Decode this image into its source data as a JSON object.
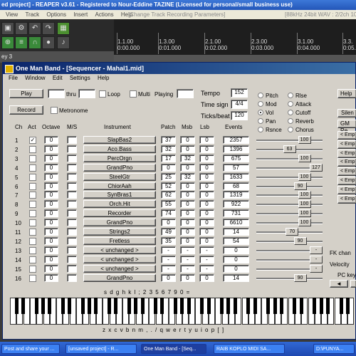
{
  "reaper": {
    "title": "ed project] - REAPER v3.61 - Registered to Nour-Eddine TAZINE (Licensed for personal/small business use)",
    "menu": [
      "View",
      "Track",
      "Options",
      "Insert",
      "Actions",
      "Help"
    ],
    "menu_info": "[Change Track Recording Parameters]",
    "menu_format": "[88kHz 24bit WAV : 2/2ch 1024sp]",
    "track_label": "ey 3",
    "timeline": [
      {
        "pos": "1.1.00",
        "time": "0:00.000"
      },
      {
        "pos": "1.3.00",
        "time": "0:01.000"
      },
      {
        "pos": "2.1.00",
        "time": "0:02.000"
      },
      {
        "pos": "2.3.00",
        "time": "0:03.000"
      },
      {
        "pos": "3.1.00",
        "time": "0:04.000"
      },
      {
        "pos": "3.3.",
        "time": "0:05."
      }
    ]
  },
  "omb": {
    "title": "One Man Band - [Sequencer - Mahal1.mid]",
    "menu": [
      "File",
      "Window",
      "Edit",
      "Settings",
      "Help"
    ],
    "play_label": "Play",
    "thru_label": "thru",
    "loop_label": "Loop",
    "multi_label": "Multi",
    "playing_label": "Playing",
    "record_label": "Record",
    "metronome_label": "Metronome",
    "tempo_label": "Tempo",
    "tempo_value": "152",
    "timesign_label": "Time sign",
    "timesign_value": "4/4",
    "ticks_label": "Ticks/beat",
    "ticks_value": "120",
    "radios": {
      "col1": [
        "Pitch",
        "Mod",
        "Vol",
        "Pan",
        "Rsnce"
      ],
      "col2": [
        "Rlse",
        "Attack",
        "Cutoff",
        "Reverb",
        "Chorus"
      ],
      "selected": "Vol"
    },
    "help_label": "Help",
    "silence_label": "Silen",
    "gmreset_label": "GM Re",
    "headers": {
      "ch": "Ch",
      "act": "Act",
      "octave": "Octave",
      "ms": "M/S",
      "instrument": "Instrument",
      "patch": "Patch",
      "msb": "Msb",
      "lsb": "Lsb",
      "events": "Events"
    },
    "rows": [
      {
        "ch": "1",
        "act": "✓",
        "oct": "0",
        "inst": "SlapBas2",
        "patch": "37",
        "msb": "0",
        "lsb": "0",
        "events": "2357",
        "vol": "100",
        "vpos": 0.78
      },
      {
        "ch": "2",
        "act": "",
        "oct": "0",
        "inst": "Aco.Bass",
        "patch": "32",
        "msb": "0",
        "lsb": "0",
        "events": "1396",
        "vol": "63",
        "vpos": 0.5
      },
      {
        "ch": "3",
        "act": "",
        "oct": "0",
        "inst": "PercOrgn",
        "patch": "17",
        "msb": "32",
        "lsb": "0",
        "events": "675",
        "vol": "100",
        "vpos": 0.78
      },
      {
        "ch": "4",
        "act": "",
        "oct": "0",
        "inst": "GrandPno",
        "patch": "0",
        "msb": "0",
        "lsb": "0",
        "events": "57",
        "vol": "127",
        "vpos": 1.0
      },
      {
        "ch": "5",
        "act": "",
        "oct": "0",
        "inst": "SteelGtr",
        "patch": "25",
        "msb": "32",
        "lsb": "0",
        "events": "1633",
        "vol": "100",
        "vpos": 0.78
      },
      {
        "ch": "6",
        "act": "",
        "oct": "0",
        "inst": "ChiorAah",
        "patch": "52",
        "msb": "0",
        "lsb": "0",
        "events": "68",
        "vol": "90",
        "vpos": 0.7
      },
      {
        "ch": "7",
        "act": "",
        "oct": "0",
        "inst": "SynBras1",
        "patch": "62",
        "msb": "0",
        "lsb": "0",
        "events": "1319",
        "vol": "100",
        "vpos": 0.78
      },
      {
        "ch": "8",
        "act": "",
        "oct": "0",
        "inst": "Orch.Hit",
        "patch": "55",
        "msb": "0",
        "lsb": "0",
        "events": "922",
        "vol": "100",
        "vpos": 0.78
      },
      {
        "ch": "9",
        "act": "",
        "oct": "0",
        "inst": "Recorder",
        "patch": "74",
        "msb": "0",
        "lsb": "0",
        "events": "731",
        "vol": "100",
        "vpos": 0.78
      },
      {
        "ch": "10",
        "act": "",
        "oct": "0",
        "inst": "GrandPno",
        "patch": "0",
        "msb": "0",
        "lsb": "0",
        "events": "6610",
        "vol": "100",
        "vpos": 0.78
      },
      {
        "ch": "11",
        "act": "",
        "oct": "0",
        "inst": "Strings2",
        "patch": "49",
        "msb": "0",
        "lsb": "0",
        "events": "14",
        "vol": "70",
        "vpos": 0.55
      },
      {
        "ch": "12",
        "act": "",
        "oct": "0",
        "inst": "Fretless",
        "patch": "35",
        "msb": "0",
        "lsb": "0",
        "events": "54",
        "vol": "90",
        "vpos": 0.7
      },
      {
        "ch": "13",
        "act": "",
        "oct": "0",
        "inst": "< unchanged >",
        "patch": "-",
        "msb": "-",
        "lsb": "-",
        "events": "0",
        "vol": "-",
        "vpos": 1.0
      },
      {
        "ch": "14",
        "act": "",
        "oct": "0",
        "inst": "< unchanged >",
        "patch": "-",
        "msb": "-",
        "lsb": "-",
        "events": "0",
        "vol": "-",
        "vpos": 1.0
      },
      {
        "ch": "15",
        "act": "",
        "oct": "0",
        "inst": "< unchanged >",
        "patch": "-",
        "msb": "-",
        "lsb": "-",
        "events": "0",
        "vol": "-",
        "vpos": 1.0
      },
      {
        "ch": "16",
        "act": "",
        "oct": "0",
        "inst": "GrandPno",
        "patch": "0",
        "msb": "0",
        "lsb": "0",
        "events": "14",
        "vol": "90",
        "vpos": 0.7
      }
    ],
    "right_buttons": [
      "< Emp",
      "< Emp",
      "< Emp",
      "< Emp",
      "< Emp",
      "< Emp",
      "< Emp",
      "< Emp"
    ],
    "fk_chan_label": "FK chan",
    "velocity_label": "Velocity",
    "pc_key_label": "PC key",
    "kb_top": "s d   g h   k l ;   2 3   5 6 7   9 0   =",
    "kb_bottom": "z x c v b n m , . / q w e r t y u i o p [ ]"
  },
  "taskbar": [
    {
      "label": "Post and share your ..."
    },
    {
      "label": "[unsaved project] - R..."
    },
    {
      "label": "One Man Band - [Seq..."
    },
    {
      "label": "RAIB KOPLO MIDI SA..."
    },
    {
      "label": "D:\\PUNYA..."
    }
  ]
}
